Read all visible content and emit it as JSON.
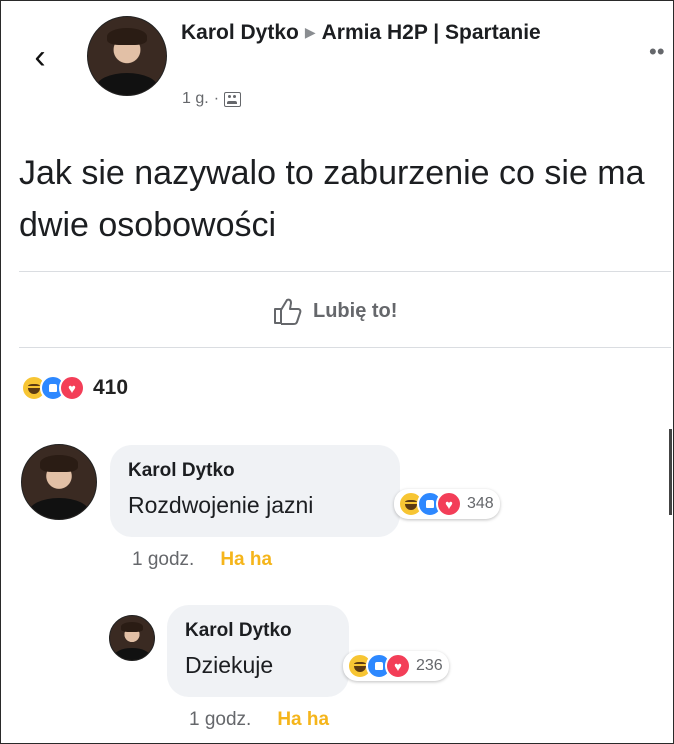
{
  "post": {
    "author": "Karol Dytko",
    "group": "Armia H2P | Spartanie",
    "time": "1 g.",
    "text": "Jak sie nazywalo to zaburzenie co sie ma dwie osobowości",
    "like_label": "Lubię to!",
    "reaction_count": "410",
    "reactions": [
      "haha-icon",
      "like-icon",
      "love-icon"
    ]
  },
  "comments": [
    {
      "author": "Karol Dytko",
      "text": "Rozdwojenie jazni",
      "reaction_count": "348",
      "time": "1 godz.",
      "reaction_label": "Ha ha"
    },
    {
      "author": "Karol Dytko",
      "text": "Dziekuje",
      "reaction_count": "236",
      "time": "1 godz.",
      "reaction_label": "Ha ha"
    }
  ],
  "colors": {
    "haha": "#f7c533",
    "like": "#2d88ff",
    "love": "#f33e58",
    "haha_text": "#f5b51b",
    "bubble": "#f0f2f5"
  }
}
